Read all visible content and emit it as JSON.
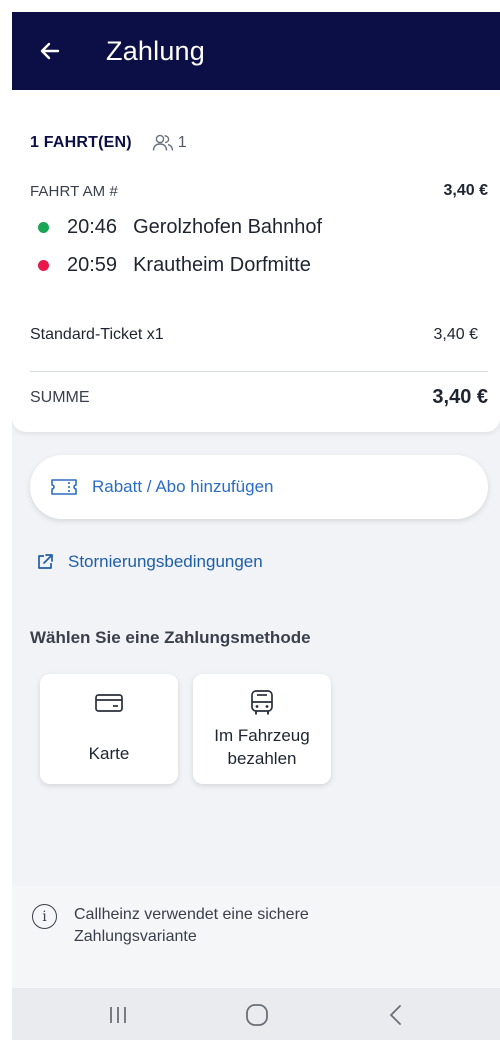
{
  "header": {
    "title": "Zahlung",
    "back_icon": "arrow-left-icon"
  },
  "summary": {
    "trips_label": "1 FAHRT(EN)",
    "passenger_count": "1",
    "ride_label": "FAHRT AM #",
    "ride_price": "3,40 €",
    "stops": [
      {
        "time": "20:46",
        "name": "Gerolzhofen Bahnhof",
        "color": "#1aa554"
      },
      {
        "time": "20:59",
        "name": "Krautheim Dorfmitte",
        "color": "#e8194a"
      }
    ],
    "ticket_label": "Standard-Ticket x1",
    "ticket_price": "3,40 €",
    "sum_label": "SUMME",
    "sum_value": "3,40 €"
  },
  "discount": {
    "label": "Rabatt / Abo hinzufügen",
    "icon": "ticket-icon"
  },
  "cancellation": {
    "label": "Stornierungsbedingungen",
    "icon": "external-link-icon"
  },
  "payment": {
    "title": "Wählen Sie eine Zahlungsmethode",
    "methods": [
      {
        "label": "Karte",
        "icon": "credit-card-icon"
      },
      {
        "label": "Im Fahrzeug bezahlen",
        "icon": "bus-icon"
      }
    ]
  },
  "info": {
    "text": "Callheinz verwendet eine sichere Zahlungsvariante",
    "icon": "info-icon"
  },
  "colors": {
    "header_bg": "#0c0f45",
    "link_blue": "#2b6cc4",
    "background": "#f1f3f7"
  },
  "navbar": {
    "icons": [
      "recent-apps-icon",
      "home-icon",
      "back-icon"
    ]
  }
}
